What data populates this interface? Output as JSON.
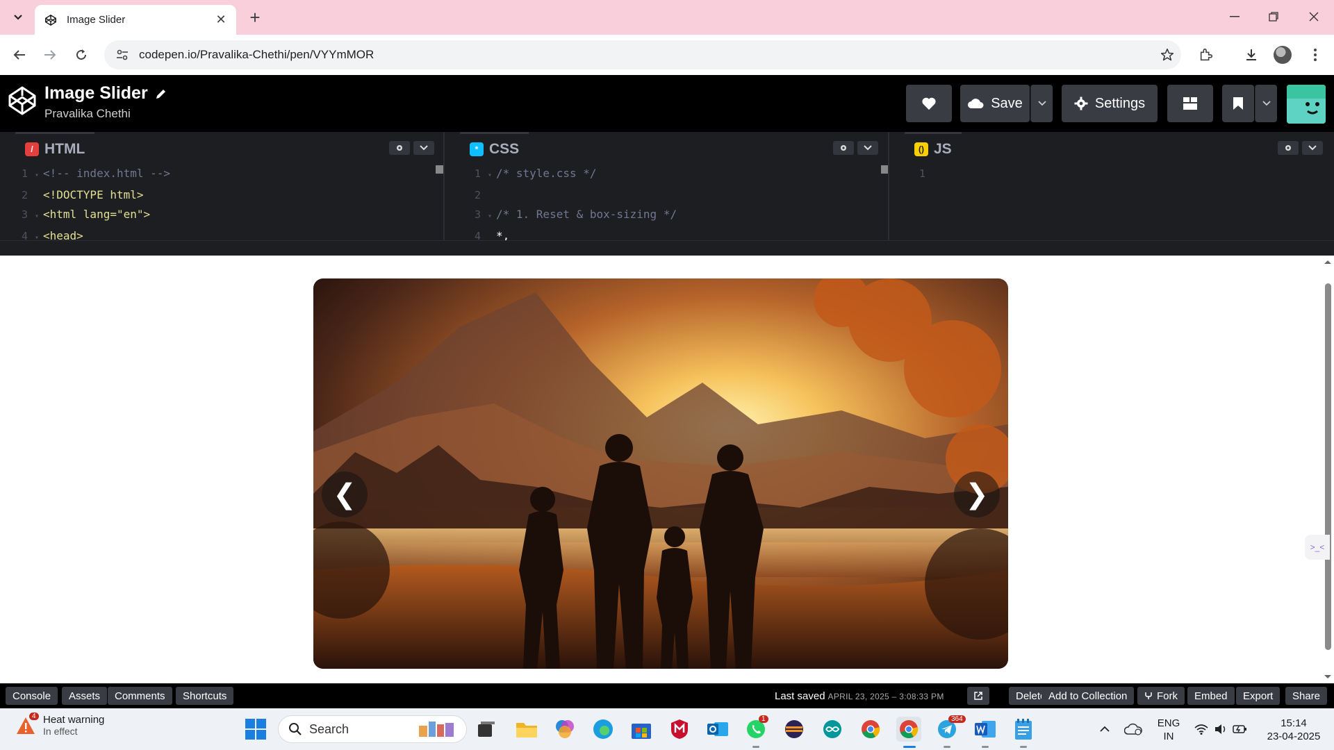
{
  "browser": {
    "tab_title": "Image Slider",
    "url": "codepen.io/Pravalika-Chethi/pen/VYYmMOR"
  },
  "codepen": {
    "pen_title": "Image Slider",
    "author": "Pravalika Chethi",
    "save_label": "Save",
    "settings_label": "Settings"
  },
  "editors": {
    "html": {
      "label": "HTML",
      "lines": [
        {
          "n": "1",
          "text": "<!-- index.html -->"
        },
        {
          "n": "2",
          "text": "<!DOCTYPE html>"
        },
        {
          "n": "3",
          "text": "<html lang=\"en\">"
        },
        {
          "n": "4",
          "text": "<head>"
        }
      ]
    },
    "css": {
      "label": "CSS",
      "lines": [
        {
          "n": "1",
          "text": "/* style.css */"
        },
        {
          "n": "2",
          "text": ""
        },
        {
          "n": "3",
          "text": "/* 1. Reset & box-sizing */"
        },
        {
          "n": "4",
          "text": "*,"
        }
      ]
    },
    "js": {
      "label": "JS",
      "lines": [
        {
          "n": "1",
          "text": ""
        }
      ]
    }
  },
  "preview": {
    "prev_arrow": "❮",
    "next_arrow": "❯"
  },
  "footer": {
    "console": "Console",
    "assets": "Assets",
    "comments": "Comments",
    "shortcuts": "Shortcuts",
    "last_saved_label": "Last saved",
    "last_saved_date": "APRIL 23, 2025 – 3:08:33 PM",
    "delete": "Delete",
    "add_to_collection": "Add to Collection",
    "fork": "Fork",
    "embed": "Embed",
    "export": "Export",
    "share": "Share"
  },
  "taskbar": {
    "weather_title": "Heat warning",
    "weather_sub": "In effect",
    "weather_badge": "4",
    "search_label": "Search",
    "whatsapp_badge": "1",
    "telegram_badge": "364",
    "lang_top": "ENG",
    "lang_bottom": "IN",
    "time": "15:14",
    "date": "23-04-2025"
  }
}
